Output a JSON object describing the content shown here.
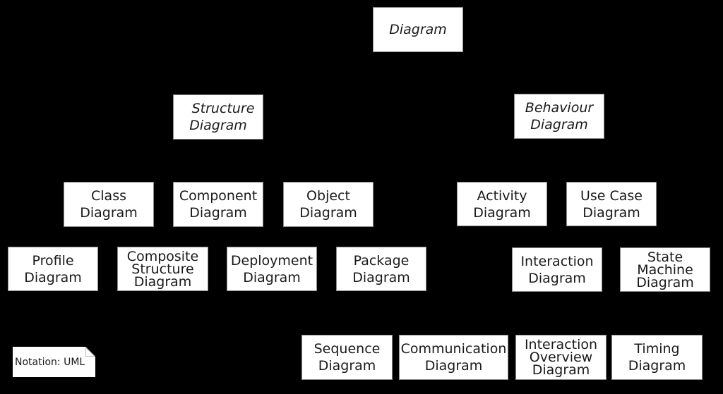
{
  "diagram": {
    "root": {
      "line1": "Diagram"
    },
    "structure": {
      "line1": "Structure",
      "line2": "Diagram"
    },
    "behaviour": {
      "line1": "Behaviour",
      "line2": "Diagram"
    },
    "class": {
      "line1": "Class",
      "line2": "Diagram"
    },
    "component": {
      "line1": "Component",
      "line2": "Diagram"
    },
    "object": {
      "line1": "Object",
      "line2": "Diagram"
    },
    "profile": {
      "line1": "Profile",
      "line2": "Diagram"
    },
    "composite": {
      "line1": "Composite",
      "line2": "Structure",
      "line3": "Diagram"
    },
    "deployment": {
      "line1": "Deployment",
      "line2": "Diagram"
    },
    "package": {
      "line1": "Package",
      "line2": "Diagram"
    },
    "activity": {
      "line1": "Activity",
      "line2": "Diagram"
    },
    "usecase": {
      "line1": "Use Case",
      "line2": "Diagram"
    },
    "interaction": {
      "line1": "Interaction",
      "line2": "Diagram"
    },
    "statemachine": {
      "line1": "State",
      "line2": "Machine",
      "line3": "Diagram"
    },
    "sequence": {
      "line1": "Sequence",
      "line2": "Diagram"
    },
    "communication": {
      "line1": "Communication",
      "line2": "Diagram"
    },
    "interactionoverview": {
      "line1": "Interaction",
      "line2": "Overview",
      "line3": "Diagram"
    },
    "timing": {
      "line1": "Timing",
      "line2": "Diagram"
    },
    "note": "Notation: UML"
  }
}
